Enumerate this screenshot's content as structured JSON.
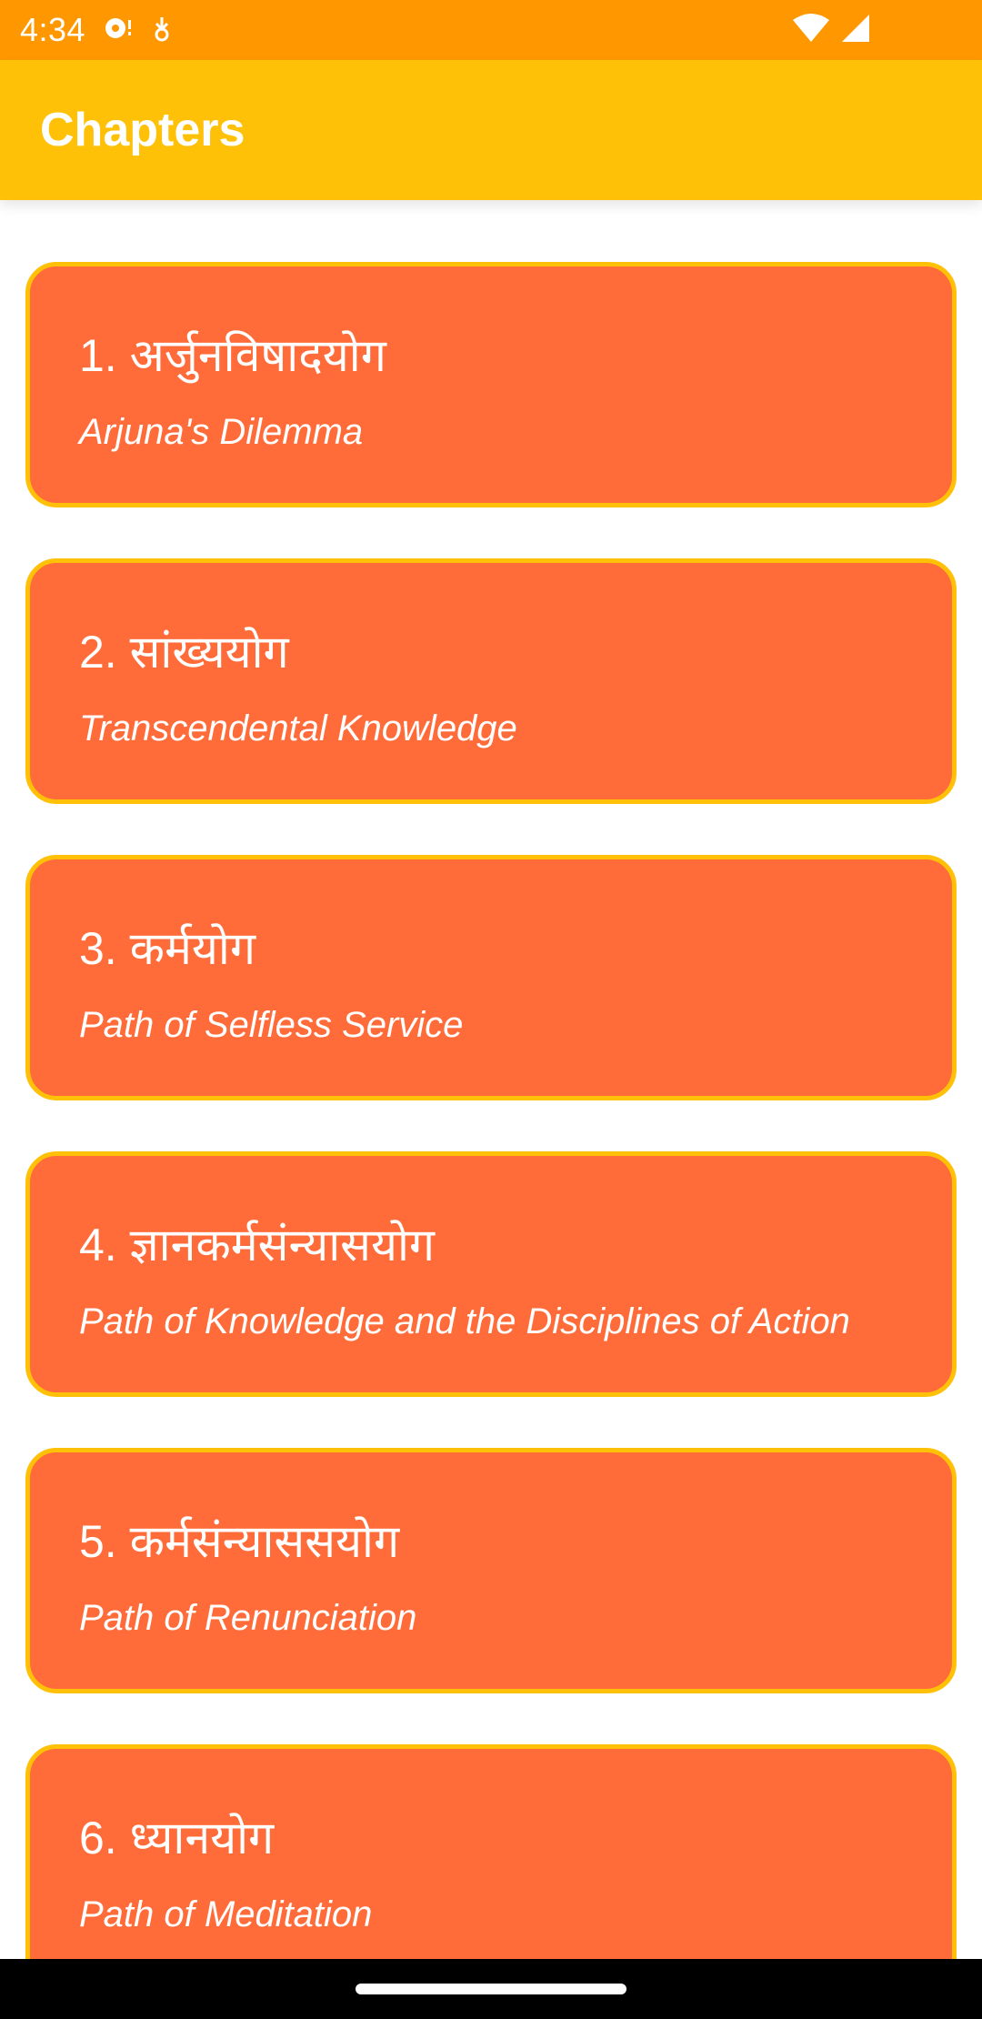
{
  "status_bar": {
    "time": "4:34",
    "icons": [
      "media-notification-icon",
      "download-notification-icon",
      "wifi-icon",
      "cell-signal-icon"
    ]
  },
  "app_bar": {
    "title": "Chapters"
  },
  "chapters": [
    {
      "title": "1. अर्जुनविषादयोग",
      "subtitle": "Arjuna's Dilemma"
    },
    {
      "title": "2. सांख्ययोग",
      "subtitle": "Transcendental Knowledge"
    },
    {
      "title": "3. कर्मयोग",
      "subtitle": "Path of Selfless Service"
    },
    {
      "title": "4. ज्ञानकर्मसंन्यासयोग",
      "subtitle": "Path of Knowledge and the Disciplines of Action"
    },
    {
      "title": "5. कर्मसंन्याससयोग",
      "subtitle": "Path of Renunciation"
    },
    {
      "title": "6. ध्यानयोग",
      "subtitle": "Path of Meditation"
    }
  ],
  "colors": {
    "status_bar": "#FF9800",
    "app_bar": "#FFC107",
    "card_fill": "#FF6B39",
    "card_border": "#FFC107",
    "text": "#FFFFFF"
  }
}
